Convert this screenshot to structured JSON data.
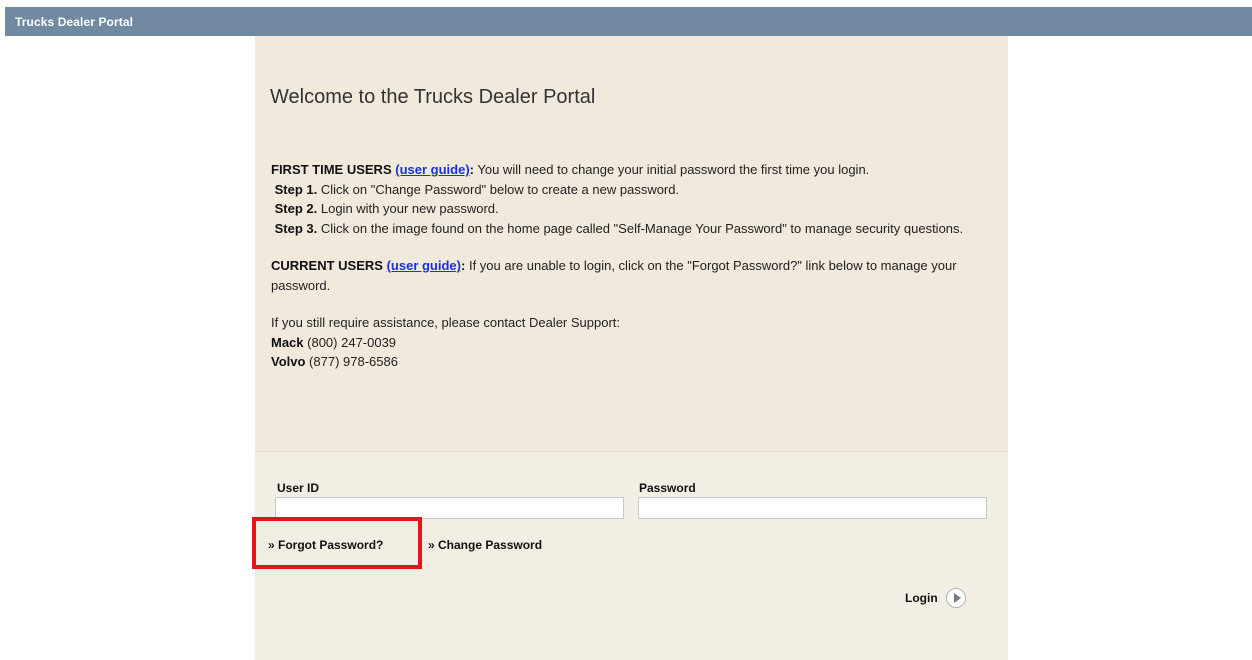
{
  "header": {
    "title": "Trucks Dealer Portal"
  },
  "info": {
    "welcome": "Welcome to the Trucks Dealer Portal",
    "first_time": {
      "label": "FIRST TIME USERS",
      "guide_link": "(user guide)",
      "colon": ":",
      "text": " You will need to change your initial password the first time you login."
    },
    "steps": [
      {
        "label": "Step 1.",
        "text": " Click on \"Change Password\" below to create a new password."
      },
      {
        "label": "Step 2.",
        "text": " Login with your new password."
      },
      {
        "label": "Step 3.",
        "text": " Click on the image found on the home page called \"Self-Manage Your Password\" to manage security questions."
      }
    ],
    "current": {
      "label": "CURRENT USERS",
      "guide_link": "(user guide)",
      "colon": ":",
      "text": " If you are unable to login, click on the \"Forgot Password?\" link below to manage your password."
    },
    "assistance": "If you still require assistance, please contact Dealer Support:",
    "contacts": [
      {
        "brand": "Mack",
        "phone": " (800) 247-0039"
      },
      {
        "brand": "Volvo",
        "phone": " (877) 978-6586"
      }
    ]
  },
  "form": {
    "user_id_label": "User ID",
    "user_id_value": "",
    "password_label": "Password",
    "password_value": "",
    "forgot_link": "» Forgot Password?",
    "change_link": "» Change Password",
    "login_label": "Login"
  },
  "colors": {
    "header_bar": "#6f8aa1",
    "panel_bg": "#f0e9dc",
    "link": "#1a33cc",
    "highlight": "#e8141b"
  }
}
